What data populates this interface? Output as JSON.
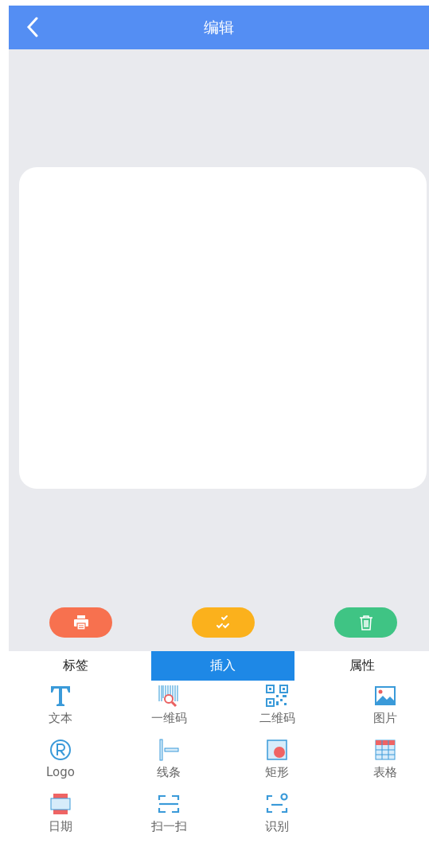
{
  "header": {
    "title": "编辑"
  },
  "actions": [
    {
      "kind": "print",
      "color": "#f7714f"
    },
    {
      "kind": "check",
      "color": "#fbb11c"
    },
    {
      "kind": "delete",
      "color": "#3fc484"
    }
  ],
  "tabs": [
    {
      "label": "标签",
      "selected": false
    },
    {
      "label": "插入",
      "selected": true
    },
    {
      "label": "属性",
      "selected": false
    }
  ],
  "tools": [
    {
      "kind": "text",
      "label": "文本"
    },
    {
      "kind": "barcode",
      "label": "一维码"
    },
    {
      "kind": "qrcode",
      "label": "二维码"
    },
    {
      "kind": "image",
      "label": "图片"
    },
    {
      "kind": "logo",
      "label": "Logo"
    },
    {
      "kind": "line",
      "label": "线条"
    },
    {
      "kind": "rect",
      "label": "矩形"
    },
    {
      "kind": "table",
      "label": "表格"
    },
    {
      "kind": "date",
      "label": "日期"
    },
    {
      "kind": "scan",
      "label": "扫一扫"
    },
    {
      "kind": "recognize",
      "label": "识别"
    }
  ]
}
